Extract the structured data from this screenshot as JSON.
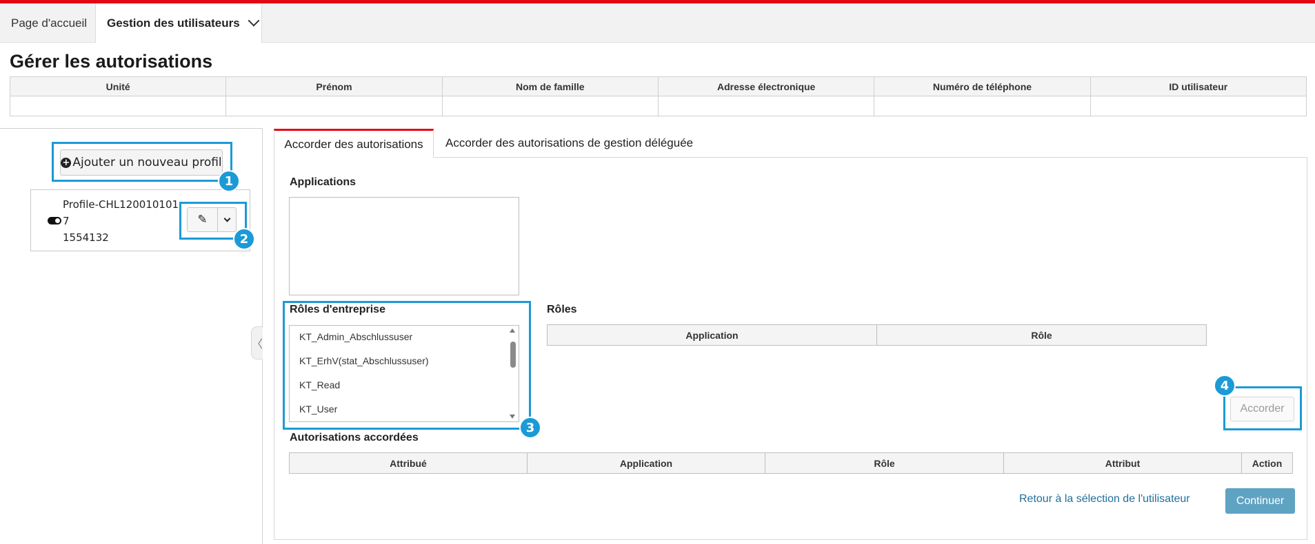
{
  "nav": {
    "home_label": "Page d'accueil",
    "users_label": "Gestion des utilisateurs"
  },
  "page": {
    "title": "Gérer les autorisations"
  },
  "user_table": {
    "headers": [
      "Unité",
      "Prénom",
      "Nom de famille",
      "Adresse électronique",
      "Numéro de téléphone",
      "ID utilisateur"
    ]
  },
  "left_panel": {
    "add_profile_label": "Ajouter un nouveau profil",
    "profile": {
      "line1": "Profile-CHL120010101",
      "line2": "7",
      "line3": "1554132"
    }
  },
  "tabs": {
    "active": "Accorder des autorisations",
    "inactive": "Accorder des autorisations de gestion déléguée"
  },
  "applications": {
    "label": "Applications"
  },
  "business_roles": {
    "label": "Rôles d'entreprise",
    "items": [
      "KT_Admin_Abschlussuser",
      "KT_ErhV(stat_Abschlussuser)",
      "KT_Read",
      "KT_User"
    ]
  },
  "roles": {
    "label": "Rôles",
    "headers": [
      "Application",
      "Rôle"
    ]
  },
  "grant_button": "Accorder",
  "granted": {
    "label": "Autorisations accordées",
    "headers": [
      "Attribué",
      "Application",
      "Rôle",
      "Attribut",
      "Action"
    ]
  },
  "footer": {
    "back_link": "Retour à la sélection de l'utilisateur",
    "continue_label": "Continuer"
  },
  "callouts": [
    "1",
    "2",
    "3",
    "4"
  ],
  "colors": {
    "brand_red": "#e30613",
    "callout_blue": "#1b9ad6",
    "primary_button": "#5fa3c2",
    "link": "#1f6f9c"
  }
}
